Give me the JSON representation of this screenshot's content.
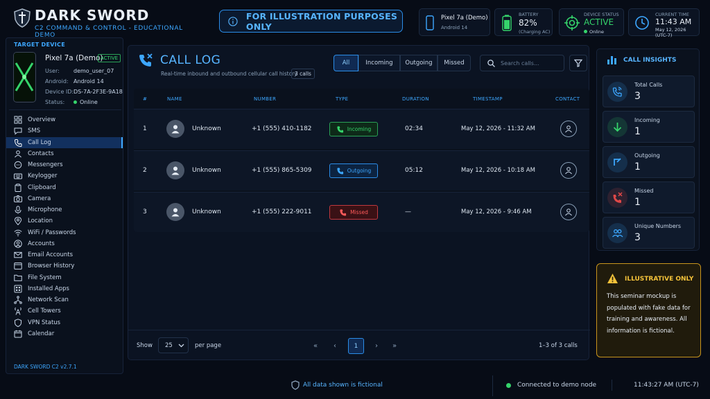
{
  "brand": {
    "title": "DARK SWORD",
    "subtitle": "C2 COMMAND & CONTROL - EDUCATIONAL DEMO"
  },
  "banner": {
    "text": "FOR ILLUSTRATION PURPOSES ONLY"
  },
  "header_device": {
    "model": "Pixel 7a (Demo)",
    "os": "Android 14"
  },
  "battery": {
    "label": "BATTERY",
    "value": "82%",
    "note": "(Charging AC)",
    "level": 0.82
  },
  "device_status": {
    "label": "DEVICE STATUS",
    "value": "ACTIVE",
    "sub": "Online"
  },
  "current_time": {
    "label": "CURRENT TIME",
    "time": "11:43 AM",
    "date": "May 12, 2026",
    "tz": "(UTC-7)"
  },
  "target_device": {
    "heading": "TARGET DEVICE",
    "model": "Pixel 7a (Demo)",
    "badge": "ACTIVE",
    "fields": [
      {
        "k": "User:",
        "v": "demo_user_07"
      },
      {
        "k": "Android:",
        "v": "Android 14"
      },
      {
        "k": "Device ID:",
        "v": "DS-7A-2F3E-9A18"
      },
      {
        "k": "Status:",
        "v": "Online"
      }
    ]
  },
  "nav": [
    {
      "label": "Overview",
      "icon": "grid-icon"
    },
    {
      "label": "SMS",
      "icon": "message-icon"
    },
    {
      "label": "Call Log",
      "icon": "phone-icon",
      "selected": true
    },
    {
      "label": "Contacts",
      "icon": "contacts-icon"
    },
    {
      "label": "Messengers",
      "icon": "chat-icon"
    },
    {
      "label": "Keylogger",
      "icon": "keyboard-icon"
    },
    {
      "label": "Clipboard",
      "icon": "clipboard-icon"
    },
    {
      "label": "Camera",
      "icon": "camera-icon"
    },
    {
      "label": "Microphone",
      "icon": "microphone-icon"
    },
    {
      "label": "Location",
      "icon": "location-icon"
    },
    {
      "label": "WiFi / Passwords",
      "icon": "wifi-icon"
    },
    {
      "label": "Accounts",
      "icon": "accounts-icon"
    },
    {
      "label": "Email Accounts",
      "icon": "email-icon"
    },
    {
      "label": "Browser History",
      "icon": "browser-icon"
    },
    {
      "label": "File System",
      "icon": "folder-icon"
    },
    {
      "label": "Installed Apps",
      "icon": "apps-icon"
    },
    {
      "label": "Network Scan",
      "icon": "network-icon"
    },
    {
      "label": "Cell Towers",
      "icon": "tower-icon"
    },
    {
      "label": "VPN Status",
      "icon": "shield-icon"
    },
    {
      "label": "Calendar",
      "icon": "calendar-icon"
    }
  ],
  "version": "DARK SWORD C2 v2.7.1",
  "calllog": {
    "title": "CALL LOG",
    "subtitle": "Real-time inbound and outbound cellular call history",
    "count": "3 calls",
    "filters": [
      "All",
      "Incoming",
      "Outgoing",
      "Missed"
    ],
    "selected_filter": "All",
    "search_placeholder": "Search calls...",
    "columns": [
      "#",
      "NAME",
      "NUMBER",
      "TYPE",
      "DURATION",
      "TIMESTAMP",
      "CONTACT"
    ],
    "rows": [
      {
        "n": "1",
        "name": "Unknown",
        "number": "+1 (555) 410-1182",
        "type": "Incoming",
        "duration": "02:34",
        "timestamp": "May 12, 2026 - 11:32 AM"
      },
      {
        "n": "2",
        "name": "Unknown",
        "number": "+1 (555) 865-5309",
        "type": "Outgoing",
        "duration": "05:12",
        "timestamp": "May 12, 2026 - 10:18 AM"
      },
      {
        "n": "3",
        "name": "Unknown",
        "number": "+1 (555) 222-9011",
        "type": "Missed",
        "duration": "—",
        "timestamp": "May 12, 2026 - 9:46 AM"
      }
    ],
    "pager": {
      "show_label": "Show",
      "per_page": "25",
      "per_page_label": "per page",
      "page": "1",
      "summary": "1–3 of 3 calls"
    }
  },
  "insights": {
    "title": "CALL INSIGHTS",
    "cards": [
      {
        "label": "Total Calls",
        "value": "3",
        "icon": "phone-signal-icon",
        "color": "#3da7ff"
      },
      {
        "label": "Incoming",
        "value": "1",
        "icon": "arrow-down-icon",
        "color": "#35d46b"
      },
      {
        "label": "Outgoing",
        "value": "1",
        "icon": "arrow-up-icon",
        "color": "#3da7ff"
      },
      {
        "label": "Missed",
        "value": "1",
        "icon": "missed-call-icon",
        "color": "#e04848"
      },
      {
        "label": "Unique Numbers",
        "value": "3",
        "icon": "users-icon",
        "color": "#3da7ff"
      }
    ]
  },
  "warning": {
    "title": "ILLUSTRATIVE ONLY",
    "body": "This seminar mockup is populated with fake data for training and awareness. All information is fictional."
  },
  "footer": {
    "notice": "All data shown is fictional",
    "connection": "Connected to demo node",
    "time": "11:43:27 AM (UTC-7)"
  },
  "colors": {
    "accent": "#3da7ff",
    "success": "#35d46b",
    "danger": "#e04848",
    "warning": "#f4c23a",
    "background": "#070c16"
  }
}
